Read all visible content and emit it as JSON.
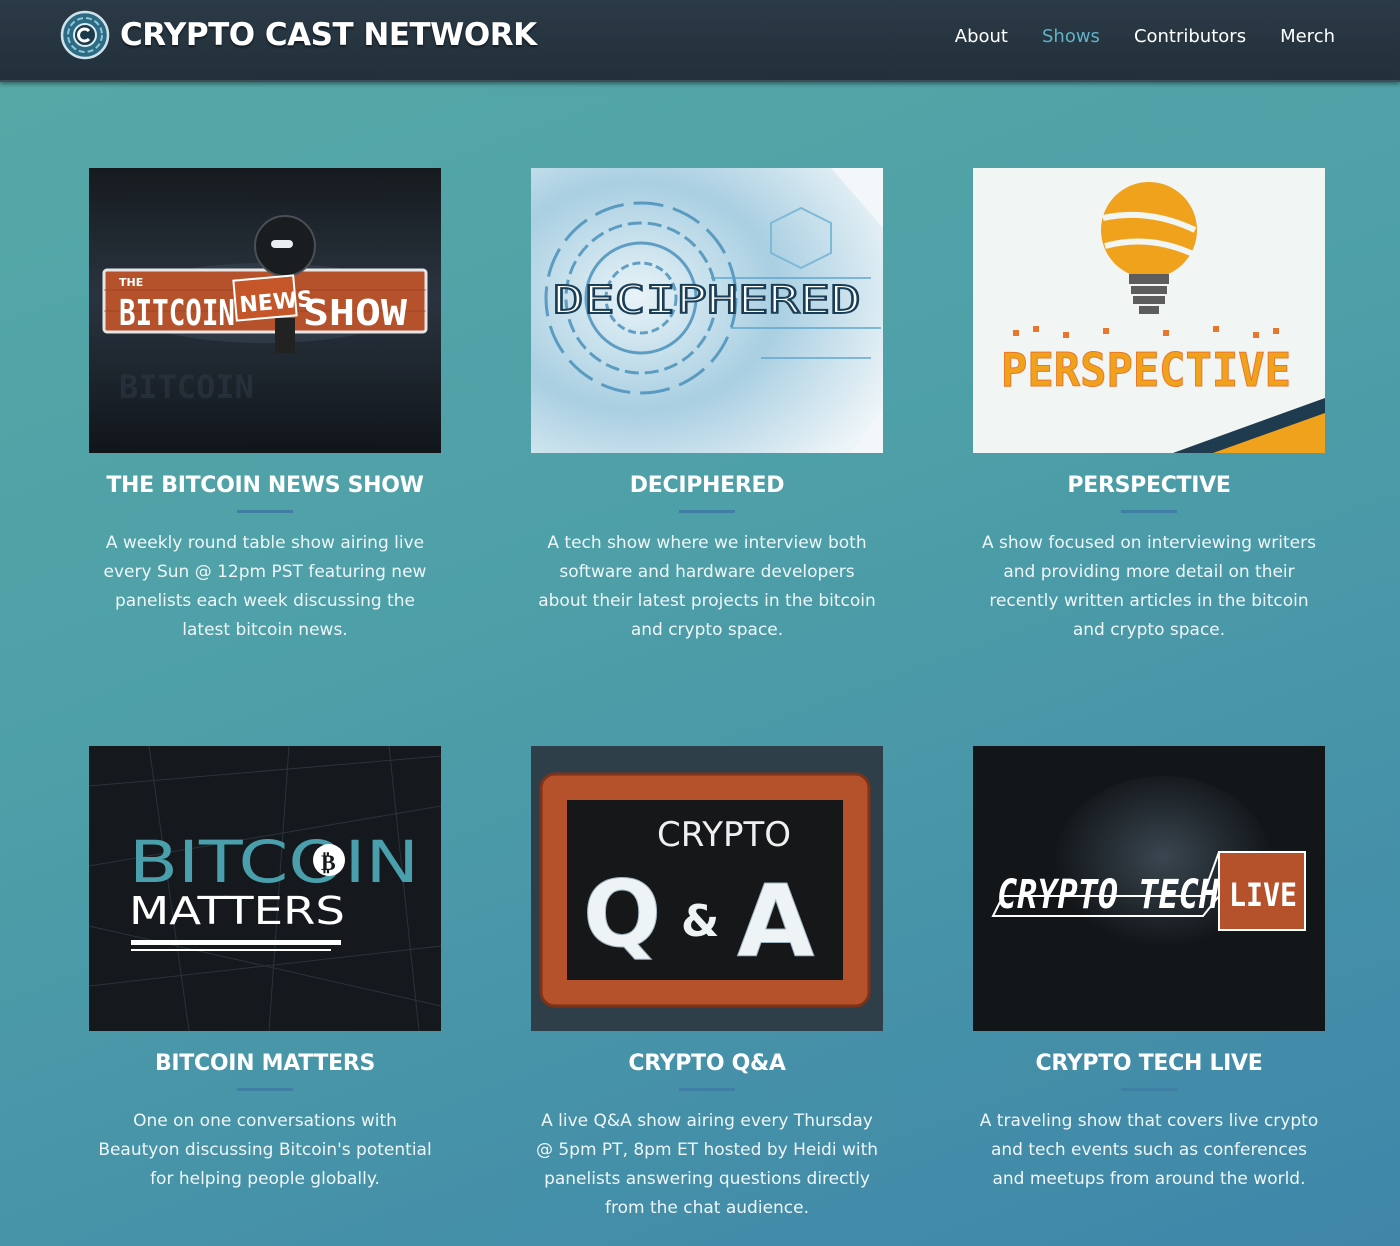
{
  "header": {
    "brand": "CRYPTO CAST NETWORK",
    "nav": [
      {
        "label": "About",
        "active": false
      },
      {
        "label": "Shows",
        "active": true
      },
      {
        "label": "Contributors",
        "active": false
      },
      {
        "label": "Merch",
        "active": false
      }
    ]
  },
  "shows": [
    {
      "title": "THE BITCOIN NEWS SHOW",
      "description": "A weekly round table show airing live every Sun @ 12pm PST featuring new panelists each week discussing the latest bitcoin news.",
      "logo_text": [
        "THE",
        "BITCOIN",
        "NEWS",
        "SHOW"
      ]
    },
    {
      "title": "DECIPHERED",
      "description": "A tech show where we interview both software and hardware developers about their latest projects in the bitcoin and crypto space.",
      "logo_text": [
        "DECIPHERED"
      ]
    },
    {
      "title": "PERSPECTIVE",
      "description": "A show focused on interviewing writers and providing more detail on their recently written articles in the bitcoin and crypto space.",
      "logo_text": [
        "PERSPECTIVE"
      ]
    },
    {
      "title": "BITCOIN MATTERS",
      "description": "One on one conversations with Beautyon discussing Bitcoin's potential for helping people globally.",
      "logo_text": [
        "BITCOIN",
        "MATTERS"
      ]
    },
    {
      "title": "CRYPTO Q&A",
      "description": "A live Q&A show airing every Thursday @ 5pm PT, 8pm ET hosted by Heidi with panelists answering questions directly from the chat audience.",
      "logo_text": [
        "CRYPTO",
        "Q",
        "&",
        "A"
      ]
    },
    {
      "title": "CRYPTO TECH LIVE",
      "description": "A traveling show that covers live crypto and tech events such as conferences and meetups from around the world.",
      "logo_text": [
        "CRYPTO TECH",
        "LIVE"
      ]
    }
  ],
  "colors": {
    "nav_active": "#5fb3c6",
    "title_rule": "#3f7fa6",
    "perspective_orange": "#f0a21c",
    "news_brick": "#b5522c"
  }
}
